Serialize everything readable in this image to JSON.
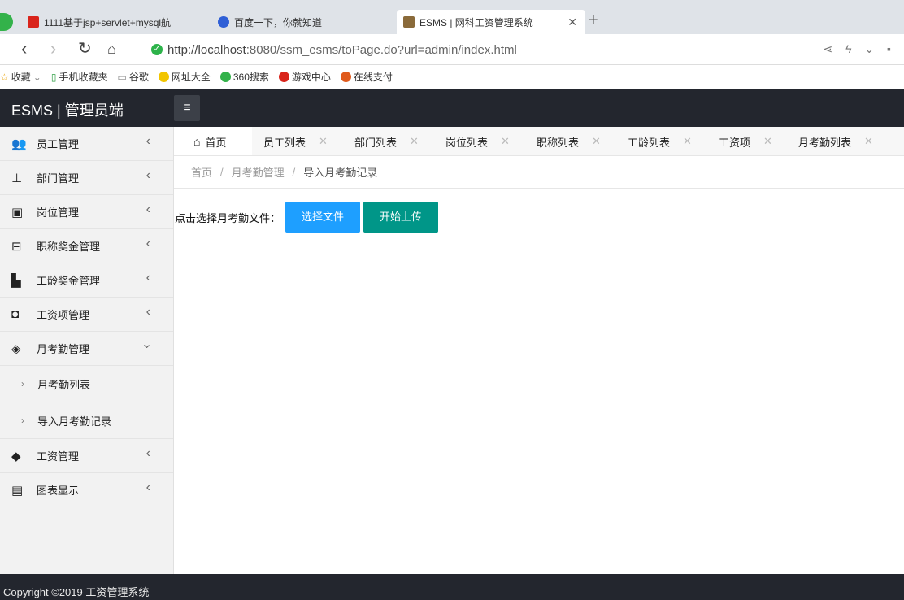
{
  "browser": {
    "tabs": [
      {
        "title": "1111基于jsp+servlet+mysql航",
        "favicon_color": "#d9241b"
      },
      {
        "title": "百度一下，你就知道",
        "favicon_color": "#2f5fd6"
      },
      {
        "title": "ESMS | 网科工资管理系统",
        "favicon_color": "#8a6a3a",
        "close": "✕"
      }
    ],
    "url_host": "http://localhost",
    "url_rest": ":8080/ssm_esms/toPage.do?url=admin/index.html",
    "bookmarks": [
      "收藏",
      "手机收藏夹",
      "谷歌",
      "网址大全",
      "360搜索",
      "游戏中心",
      "在线支付"
    ]
  },
  "app": {
    "title": "ESMS | 管理员端",
    "sidebar": {
      "items": [
        {
          "label": "员工管理",
          "icon": "user-group-icon"
        },
        {
          "label": "部门管理",
          "icon": "sitemap-icon"
        },
        {
          "label": "岗位管理",
          "icon": "id-card-icon"
        },
        {
          "label": "职称奖金管理",
          "icon": "briefcase-icon"
        },
        {
          "label": "工龄奖金管理",
          "icon": "building-icon"
        },
        {
          "label": "工资项管理",
          "icon": "money-icon"
        },
        {
          "label": "月考勤管理",
          "icon": "layers-icon",
          "expanded": true,
          "children": [
            "月考勤列表",
            "导入月考勤记录"
          ]
        },
        {
          "label": "工资管理",
          "icon": "tag-icon"
        },
        {
          "label": "图表显示",
          "icon": "book-icon"
        }
      ]
    },
    "content_tabs": [
      "首页",
      "员工列表",
      "部门列表",
      "岗位列表",
      "职称列表",
      "工龄列表",
      "工资项",
      "月考勤列表"
    ],
    "breadcrumb": {
      "home": "首页",
      "section": "月考勤管理",
      "current": "导入月考勤记录",
      "separator": "/"
    },
    "upload": {
      "label": "点击选择月考勤文件：",
      "select_button": "选择文件",
      "upload_button": "开始上传"
    },
    "footer": "Copyright ©2019 工资管理系统"
  },
  "colors": {
    "header_bg": "#23262e",
    "sidebar_bg": "#f2f2f2",
    "button_blue": "#1e9fff",
    "button_green": "#009688"
  }
}
